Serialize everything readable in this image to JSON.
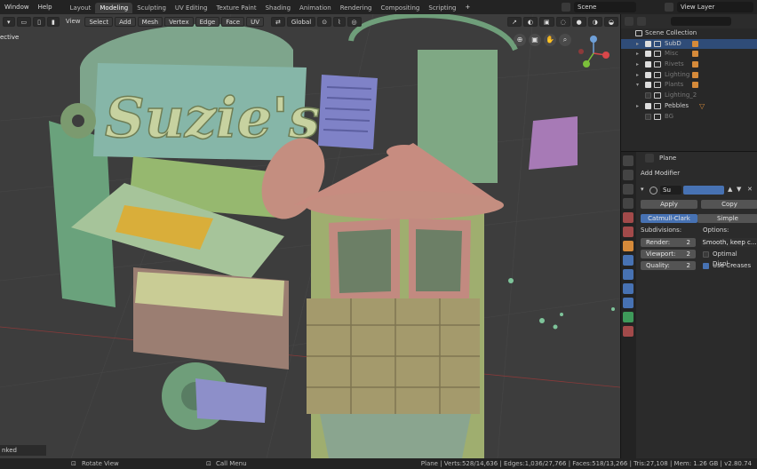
{
  "topbar": {
    "menus": [
      "Window",
      "Help"
    ],
    "workspaces": [
      "Layout",
      "Modeling",
      "Sculpting",
      "UV Editing",
      "Texture Paint",
      "Shading",
      "Animation",
      "Rendering",
      "Compositing",
      "Scripting"
    ],
    "active_workspace": "Modeling",
    "add_tab": "+",
    "scene": "Scene",
    "view_layer": "View Layer"
  },
  "viewport": {
    "menus": [
      "View",
      "Select",
      "Add",
      "Mesh",
      "Vertex",
      "Edge",
      "Face",
      "UV"
    ],
    "transform_orientation": "Global",
    "perspective_label": "ective",
    "linked_label": "nked",
    "sign_text": "Suzie's"
  },
  "outliner": {
    "root": "Scene Collection",
    "items": [
      {
        "name": "SubD",
        "selected": true,
        "checked": true,
        "expand": "▸",
        "dim": false
      },
      {
        "name": "Misc",
        "selected": false,
        "checked": true,
        "expand": "▸",
        "dim": true
      },
      {
        "name": "Rivets",
        "selected": false,
        "checked": true,
        "expand": "▸",
        "dim": true
      },
      {
        "name": "Lighting",
        "selected": false,
        "checked": true,
        "expand": "▸",
        "dim": true
      },
      {
        "name": "Plants",
        "selected": false,
        "checked": true,
        "expand": "▾",
        "dim": true
      },
      {
        "name": "Lighting_2",
        "selected": false,
        "checked": false,
        "expand": "",
        "dim": true
      },
      {
        "name": "Pebbles",
        "selected": false,
        "checked": true,
        "expand": "▸",
        "dim": false
      },
      {
        "name": "BG",
        "selected": false,
        "checked": false,
        "expand": "",
        "dim": true
      }
    ]
  },
  "properties": {
    "object_name": "Plane",
    "add_modifier": "Add Modifier",
    "modifier_name": "Su",
    "apply": "Apply",
    "copy": "Copy",
    "catmull": "Catmull-Clark",
    "simple": "Simple",
    "subdivisions_label": "Subdivisions:",
    "options_label": "Options:",
    "render_label": "Render:",
    "render_value": "2",
    "viewport_label": "Viewport:",
    "viewport_value": "2",
    "quality_label": "Quality:",
    "quality_value": "2",
    "smooth_option": "Smooth, keep c...",
    "optimal_display": "Optimal Displ...",
    "use_creases": "Use Creases"
  },
  "status": {
    "rotate": "Rotate View",
    "call_menu": "Call Menu",
    "stats": "Plane | Verts:528/14,636 | Edges:1,036/27,766 | Faces:518/13,266 | Tris:27,108 | Mem: 1.26 GB | v2.80.74"
  },
  "colors": {
    "accent": "#4772b3",
    "selection": "#2f4c78",
    "viewport_bg": "#3d3d3d",
    "modifier_orange": "#d58a3a"
  }
}
